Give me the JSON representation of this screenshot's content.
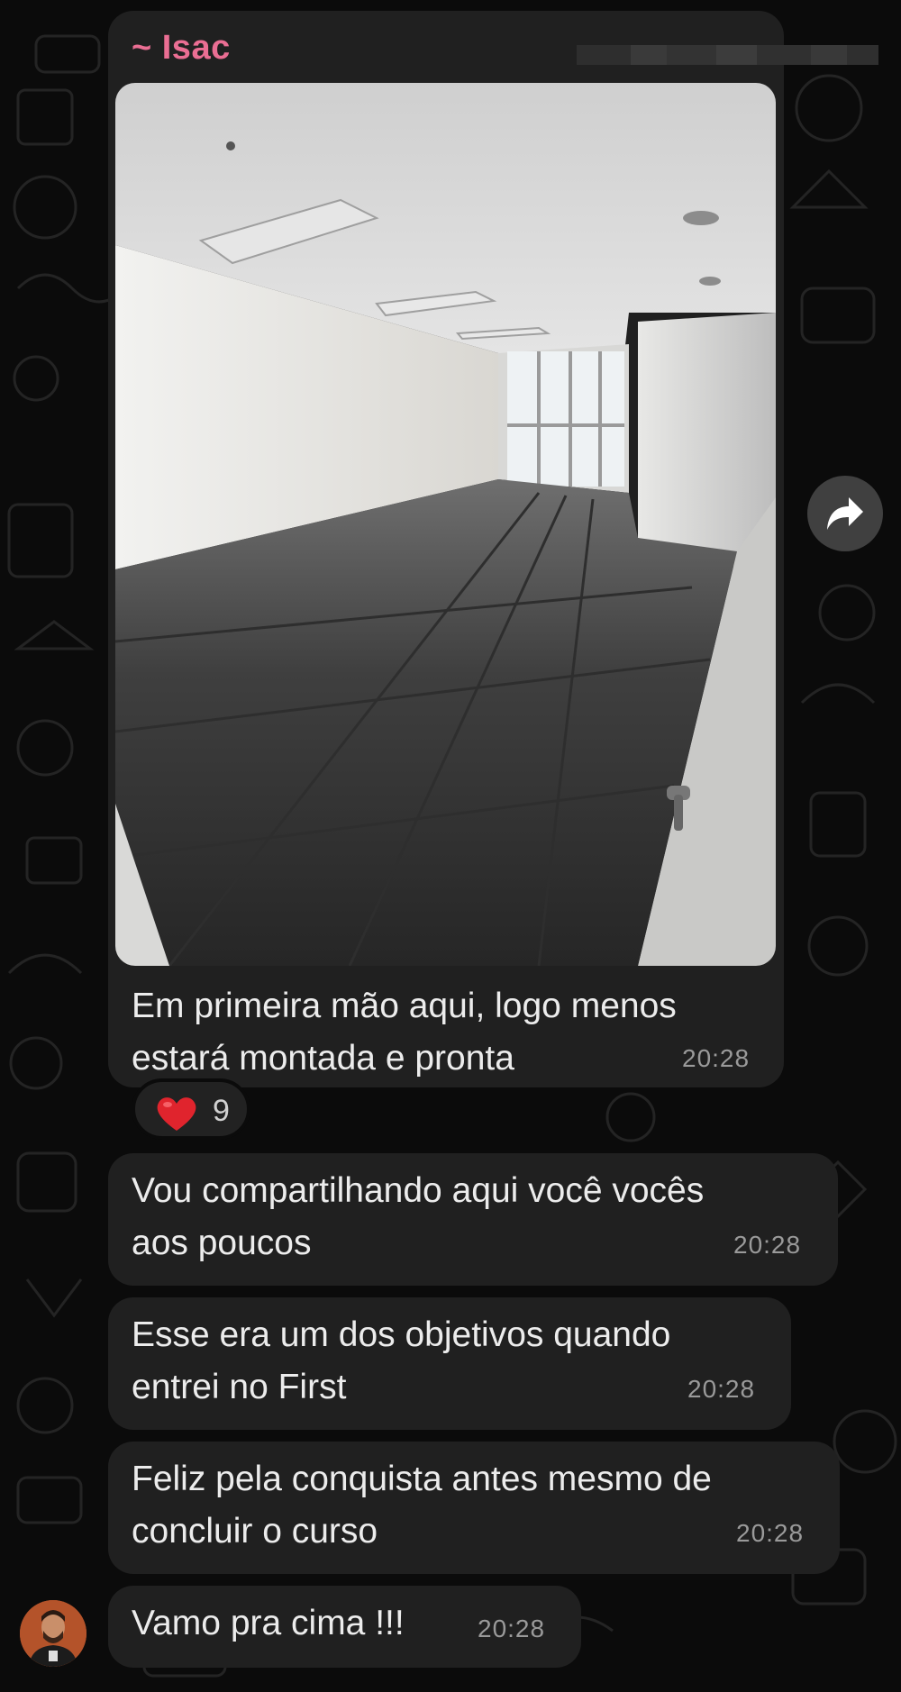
{
  "chat": {
    "sender_name": "~ Isac",
    "messages": [
      {
        "type": "photo",
        "caption_lines": [
          "Em primeira mão aqui, logo menos",
          "estará montada e pronta"
        ],
        "time": "20:28",
        "reaction": {
          "emoji": "heart",
          "count": "9"
        }
      },
      {
        "lines": [
          "Vou compartilhando aqui você vocês",
          "aos poucos"
        ],
        "time": "20:28"
      },
      {
        "lines": [
          "Esse era um dos objetivos quando",
          "entrei no First"
        ],
        "time": "20:28"
      },
      {
        "lines": [
          "Feliz pela conquista antes mesmo de",
          "concluir o curso"
        ],
        "time": "20:28"
      },
      {
        "lines": [
          "Vamo pra cima !!!"
        ],
        "time": "20:28"
      }
    ]
  },
  "colors": {
    "background": "#0b0b0b",
    "bubble": "#202020",
    "sender_name": "#ea6e93",
    "timestamp": "#9a9a9a",
    "text": "#ececec"
  },
  "icons": {
    "forward": "forward-arrow-icon",
    "reaction": "red-heart-icon",
    "avatar": "user-avatar"
  }
}
